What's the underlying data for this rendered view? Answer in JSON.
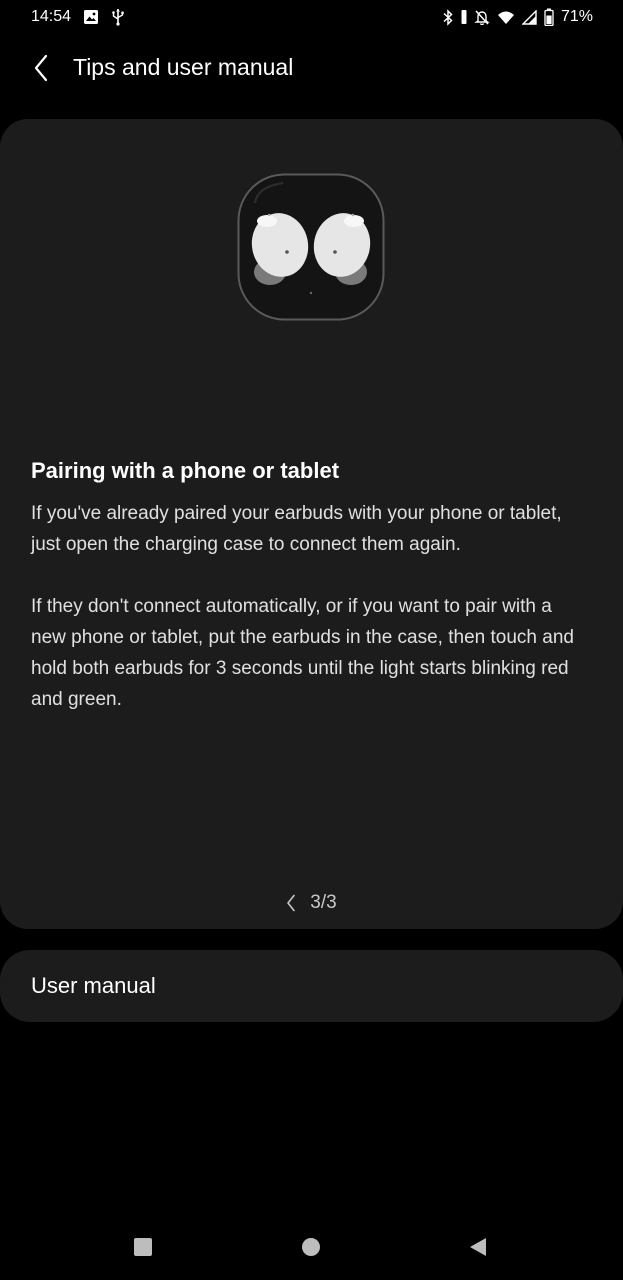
{
  "status_bar": {
    "time": "14:54",
    "battery": "71%",
    "icons_left": [
      "gallery-icon",
      "usb-icon"
    ],
    "icons_right": [
      "bluetooth-icon",
      "vibrate-icon",
      "mute-icon",
      "wifi-icon",
      "signal-icon",
      "battery-icon"
    ]
  },
  "header": {
    "title": "Tips and user manual",
    "back_icon": "chevron-left-icon"
  },
  "tip": {
    "title": "Pairing with a phone or tablet",
    "paragraph1": "If you've already paired your earbuds with your phone or tablet, just open the charging case to connect them again.",
    "paragraph2": "If they don't connect automatically, or if you want to pair with a new phone or tablet, put the earbuds in the case, then touch and hold both earbuds for 3 seconds until the light starts blinking red and green.",
    "pager": "3/3",
    "current_page": 3,
    "total_pages": 3
  },
  "user_manual": {
    "label": "User manual"
  },
  "nav_bar": {
    "icons": [
      "recents-icon",
      "home-icon",
      "back-icon"
    ]
  },
  "colors": {
    "background": "#000000",
    "card": "#1c1c1c",
    "text_primary": "#ffffff",
    "text_secondary": "#e0e0e0"
  }
}
